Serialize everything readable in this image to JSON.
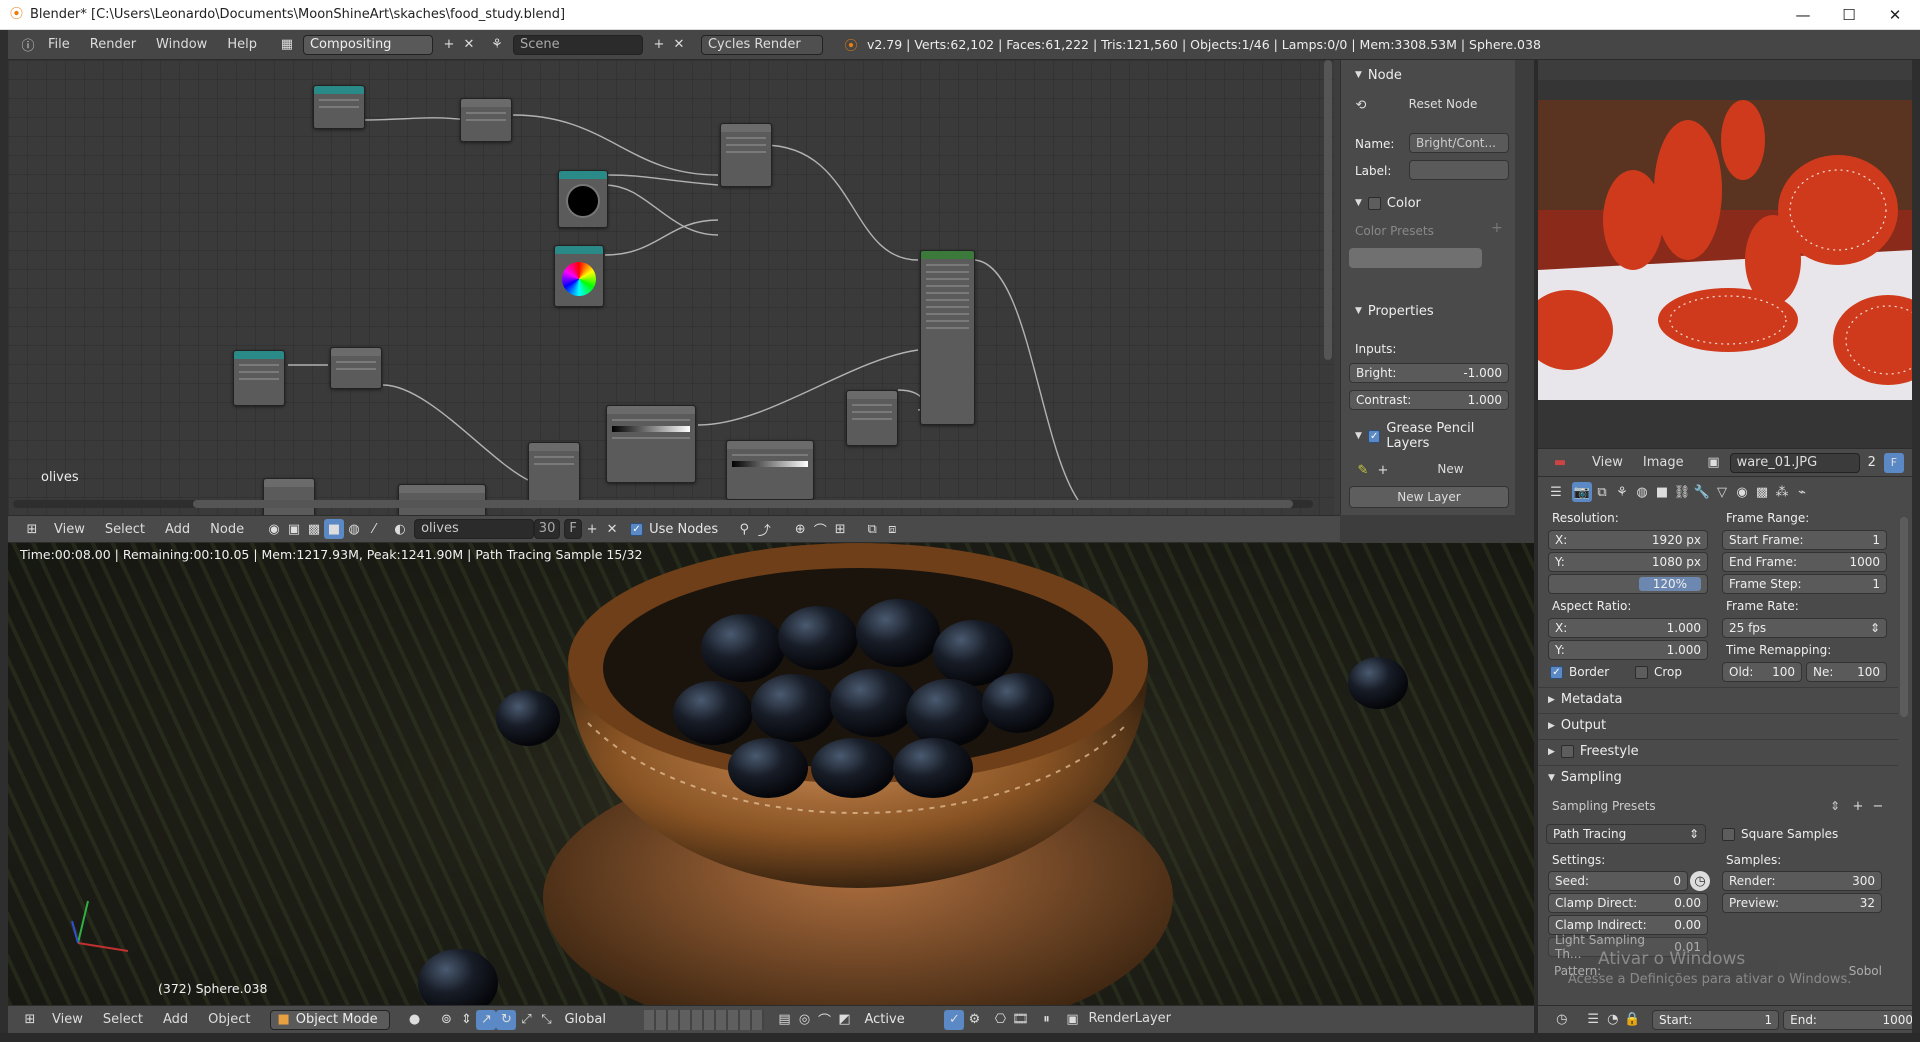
{
  "window": {
    "title": "Blender* [C:\\Users\\Leonardo\\Documents\\MoonShineArt\\skaches\\food_study.blend]",
    "min": "—",
    "max": "☐",
    "close": "✕"
  },
  "info_header": {
    "menus": [
      "File",
      "Render",
      "Window",
      "Help"
    ],
    "screen_layout": "Compositing",
    "scene": "Scene",
    "engine": "Cycles Render",
    "stats": "v2.79 | Verts:62,102 | Faces:61,222 | Tris:121,560 | Objects:1/46 | Lamps:0/0 | Mem:3308.53M | Sphere.038"
  },
  "node_editor": {
    "label": "olives",
    "header": {
      "menus": [
        "View",
        "Select",
        "Add",
        "Node"
      ],
      "node_tree": "olives",
      "users": "30",
      "fake_user": "F",
      "use_nodes": "Use Nodes"
    }
  },
  "n_panel": {
    "node_title": "Node",
    "reset_node": "Reset Node",
    "name_label": "Name:",
    "name_value": "Bright/Cont...",
    "label_label": "Label:",
    "label_value": "",
    "color_title": "Color",
    "color_presets": "Color Presets",
    "properties_title": "Properties",
    "inputs_label": "Inputs:",
    "bright_label": "Bright:",
    "bright_value": "-1.000",
    "contrast_label": "Contrast:",
    "contrast_value": "1.000",
    "gp_title": "Grease Pencil Layers",
    "gp_new": "New",
    "gp_new_layer": "New Layer"
  },
  "render_view": {
    "status": "Time:00:08.00 | Remaining:00:10.05 | Mem:1217.93M, Peak:1241.90M | Path Tracing Sample 15/32",
    "object_label": "(372) Sphere.038"
  },
  "bottom_header": {
    "menus": [
      "View",
      "Select",
      "Add",
      "Object"
    ],
    "mode": "Object Mode",
    "orientation": "Global",
    "pivot": "Active",
    "render_layer": "RenderLayer"
  },
  "image_editor": {
    "menus": [
      "View",
      "Image"
    ],
    "image_name": "ware_01.JPG",
    "users": "2",
    "fake": "F"
  },
  "properties": {
    "resolution_label": "Resolution:",
    "res_x_label": "X:",
    "res_x": "1920 px",
    "res_y_label": "Y:",
    "res_y": "1080 px",
    "res_pct": "120%",
    "aspect_label": "Aspect Ratio:",
    "asp_x_label": "X:",
    "asp_x": "1.000",
    "asp_y_label": "Y:",
    "asp_y": "1.000",
    "border": "Border",
    "crop": "Crop",
    "frame_range_label": "Frame Range:",
    "start_frame_label": "Start Frame:",
    "start_frame": "1",
    "end_frame_label": "End Frame:",
    "end_frame": "1000",
    "frame_step_label": "Frame Step:",
    "frame_step": "1",
    "frame_rate_label": "Frame Rate:",
    "frame_rate": "25 fps",
    "time_remap_label": "Time Remapping:",
    "old_label": "Old:",
    "old_value": "100",
    "new_label": "Ne:",
    "new_value": "100",
    "metadata": "Metadata",
    "output": "Output",
    "freestyle": "Freestyle",
    "sampling": "Sampling",
    "sampling_presets": "Sampling Presets",
    "integrator": "Path Tracing",
    "square_samples": "Square Samples",
    "settings_label": "Settings:",
    "seed_label": "Seed:",
    "seed": "0",
    "clamp_direct_label": "Clamp Direct:",
    "clamp_direct": "0.00",
    "clamp_indirect_label": "Clamp Indirect:",
    "clamp_indirect": "0.00",
    "light_thresh_label": "Light Sampling Th...",
    "light_thresh": "0.01",
    "samples_label": "Samples:",
    "render_label": "Render:",
    "render_samples": "300",
    "preview_label": "Preview:",
    "preview_samples": "32",
    "pattern_label": "Pattern:",
    "pattern_value": "Sobol",
    "watermark_1": "Ativar o Windows",
    "watermark_2": "Acesse a Definições para ativar o Windows."
  },
  "timeline": {
    "start_label": "Start:",
    "start": "1",
    "end_label": "End:",
    "end": "1000"
  },
  "colors": {
    "accent": "#5a89c6",
    "panel": "#4a4a4a",
    "field": "#2b2b2b",
    "blender_orange": "#e87d0d"
  }
}
